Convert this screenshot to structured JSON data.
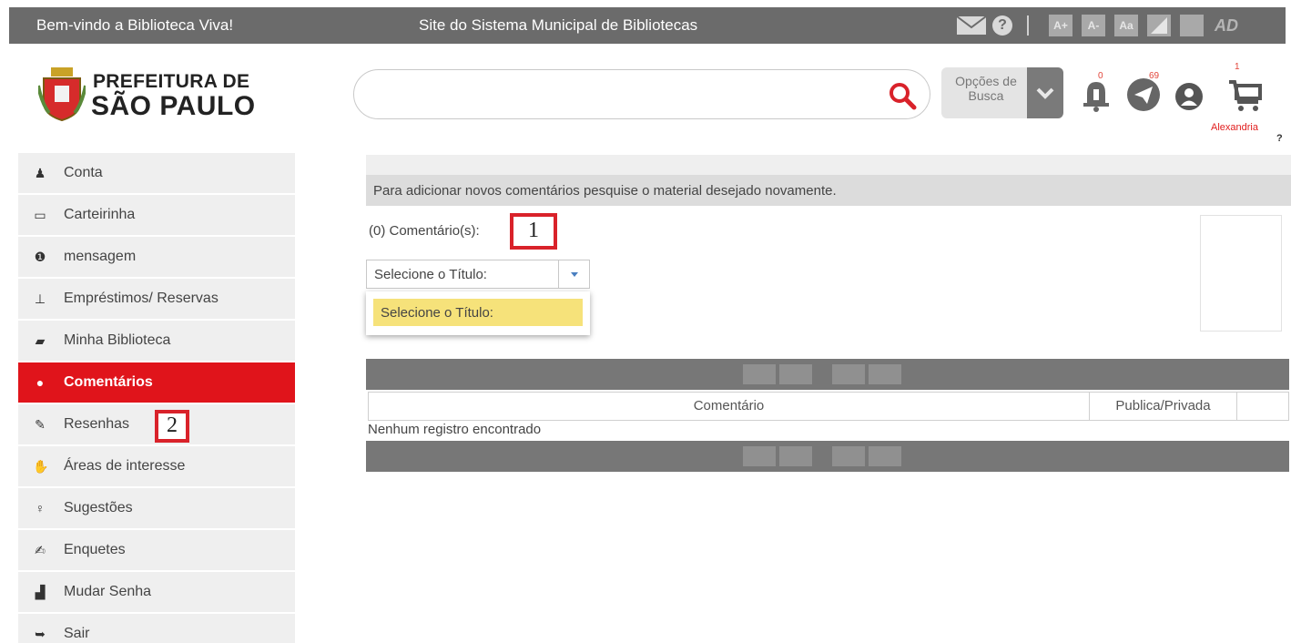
{
  "topbar": {
    "welcome": "Bem-vindo a Biblioteca Viva!",
    "site_link": "Site do Sistema Municipal de Bibliotecas",
    "help_label": "?",
    "font_buttons": [
      "A+",
      "A-",
      "Aa"
    ],
    "ad_label": "AD"
  },
  "header": {
    "logo_line1": "PREFEITURA DE",
    "logo_line2": "SÃO PAULO",
    "search_placeholder": "",
    "search_options_label": "Opções de Busca",
    "notifications_count": "0",
    "messages_count": "69",
    "cart_count": "1",
    "cart_user": "Alexandria",
    "cart_help": "?"
  },
  "sidebar": {
    "items": [
      {
        "label": "Conta",
        "icon": "user-icon",
        "glyph": "♟"
      },
      {
        "label": "Carteirinha",
        "icon": "card-icon",
        "glyph": "▭"
      },
      {
        "label": "mensagem",
        "icon": "info-icon",
        "glyph": "❶"
      },
      {
        "label": "Empréstimos/ Reservas",
        "icon": "pin-icon",
        "glyph": "⊥"
      },
      {
        "label": "Minha Biblioteca",
        "icon": "book-icon",
        "glyph": "▰"
      },
      {
        "label": "Comentários",
        "icon": "comment-icon",
        "glyph": "●"
      },
      {
        "label": "Resenhas",
        "icon": "pencil-icon",
        "glyph": "✎"
      },
      {
        "label": "Áreas de interesse",
        "icon": "thumbs-up-icon",
        "glyph": "✋"
      },
      {
        "label": "Sugestões",
        "icon": "lightbulb-icon",
        "glyph": "♀"
      },
      {
        "label": "Enquetes",
        "icon": "edit-icon",
        "glyph": "✍"
      },
      {
        "label": "Mudar Senha",
        "icon": "unlock-icon",
        "glyph": "▟"
      },
      {
        "label": "Sair",
        "icon": "sign-out-icon",
        "glyph": "➥"
      }
    ],
    "active_index": 5
  },
  "main": {
    "notice": "Para adicionar novos comentários pesquise o material desejado novamente.",
    "comment_count": "(0) Comentário(s):",
    "select_value": "Selecione o Título:",
    "dropdown_option": "Selecione o Título:",
    "table": {
      "columns": [
        "Comentário",
        "Publica/Privada"
      ],
      "empty_text": "Nenhum registro encontrado"
    }
  },
  "markers": {
    "first": "1",
    "second": "2"
  },
  "colors": {
    "topbar": "#6b6b6b",
    "accent_red": "#e0141b",
    "highlight_yellow": "#f6e27a"
  }
}
